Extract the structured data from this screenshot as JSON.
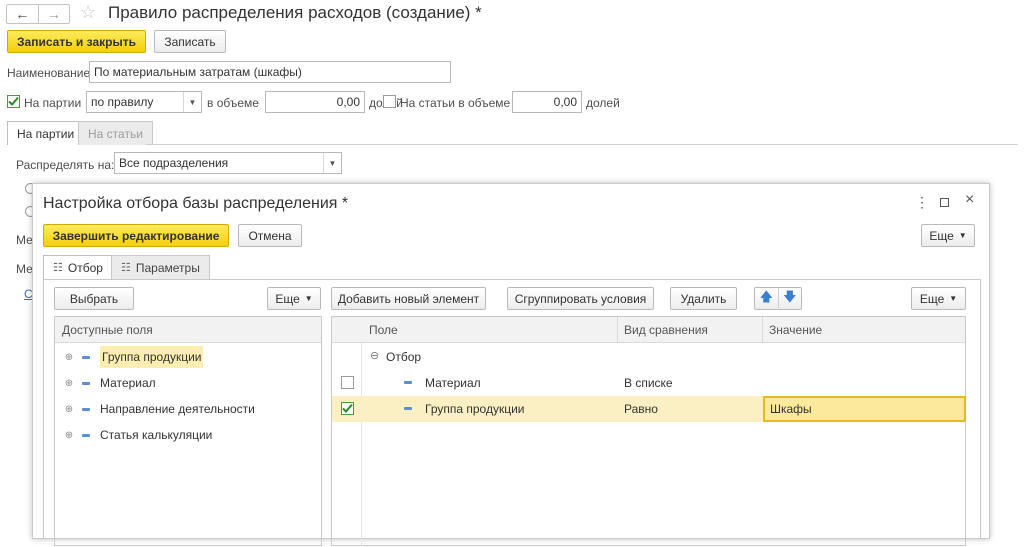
{
  "window": {
    "title": "Правило распределения расходов (создание) *"
  },
  "toolbar": {
    "save_close_label": "Записать и закрыть",
    "save_label": "Записать"
  },
  "form": {
    "name_label": "Наименование:",
    "name_value": "По материальным затратам (шкафы)",
    "by_batch_label": "На партии",
    "by_batch_checked": true,
    "rule_value": "по правилу",
    "volume_label": "в объеме",
    "volume_value": "0,00",
    "shares_label": "долей",
    "by_items_label": "На статьи в объеме",
    "by_items_checked": false,
    "items_volume_value": "0,00",
    "items_shares_label": "долей"
  },
  "tabs": [
    {
      "label": "На партии",
      "active": true
    },
    {
      "label": "На статьи",
      "active": false
    }
  ],
  "distribute": {
    "label": "Распределять на:",
    "value": "Все подразделения"
  },
  "background_fragments": [
    "Ме",
    "Ме",
    "С"
  ],
  "dialog": {
    "title": "Настройка отбора базы распределения *",
    "finish_label": "Завершить редактирование",
    "cancel_label": "Отмена",
    "more_label": "Еще",
    "tabs": [
      {
        "label": "Отбор",
        "active": true
      },
      {
        "label": "Параметры",
        "active": false
      }
    ],
    "left": {
      "select_label": "Выбрать",
      "more_label": "Еще",
      "header": "Доступные поля",
      "items": [
        {
          "label": "Группа продукции",
          "highlighted": true
        },
        {
          "label": "Материал",
          "highlighted": false
        },
        {
          "label": "Направление деятельности",
          "highlighted": false
        },
        {
          "label": "Статья калькуляции",
          "highlighted": false
        }
      ]
    },
    "right": {
      "add_label": "Добавить новый элемент",
      "group_label": "Сгруппировать условия",
      "delete_label": "Удалить",
      "more_label": "Еще",
      "columns": [
        "Поле",
        "Вид сравнения",
        "Значение"
      ],
      "group_row": "Отбор",
      "rows": [
        {
          "checked": false,
          "field": "Материал",
          "comparison": "В списке",
          "value": ""
        },
        {
          "checked": true,
          "field": "Группа продукции",
          "comparison": "Равно",
          "value": "Шкафы"
        }
      ]
    }
  }
}
